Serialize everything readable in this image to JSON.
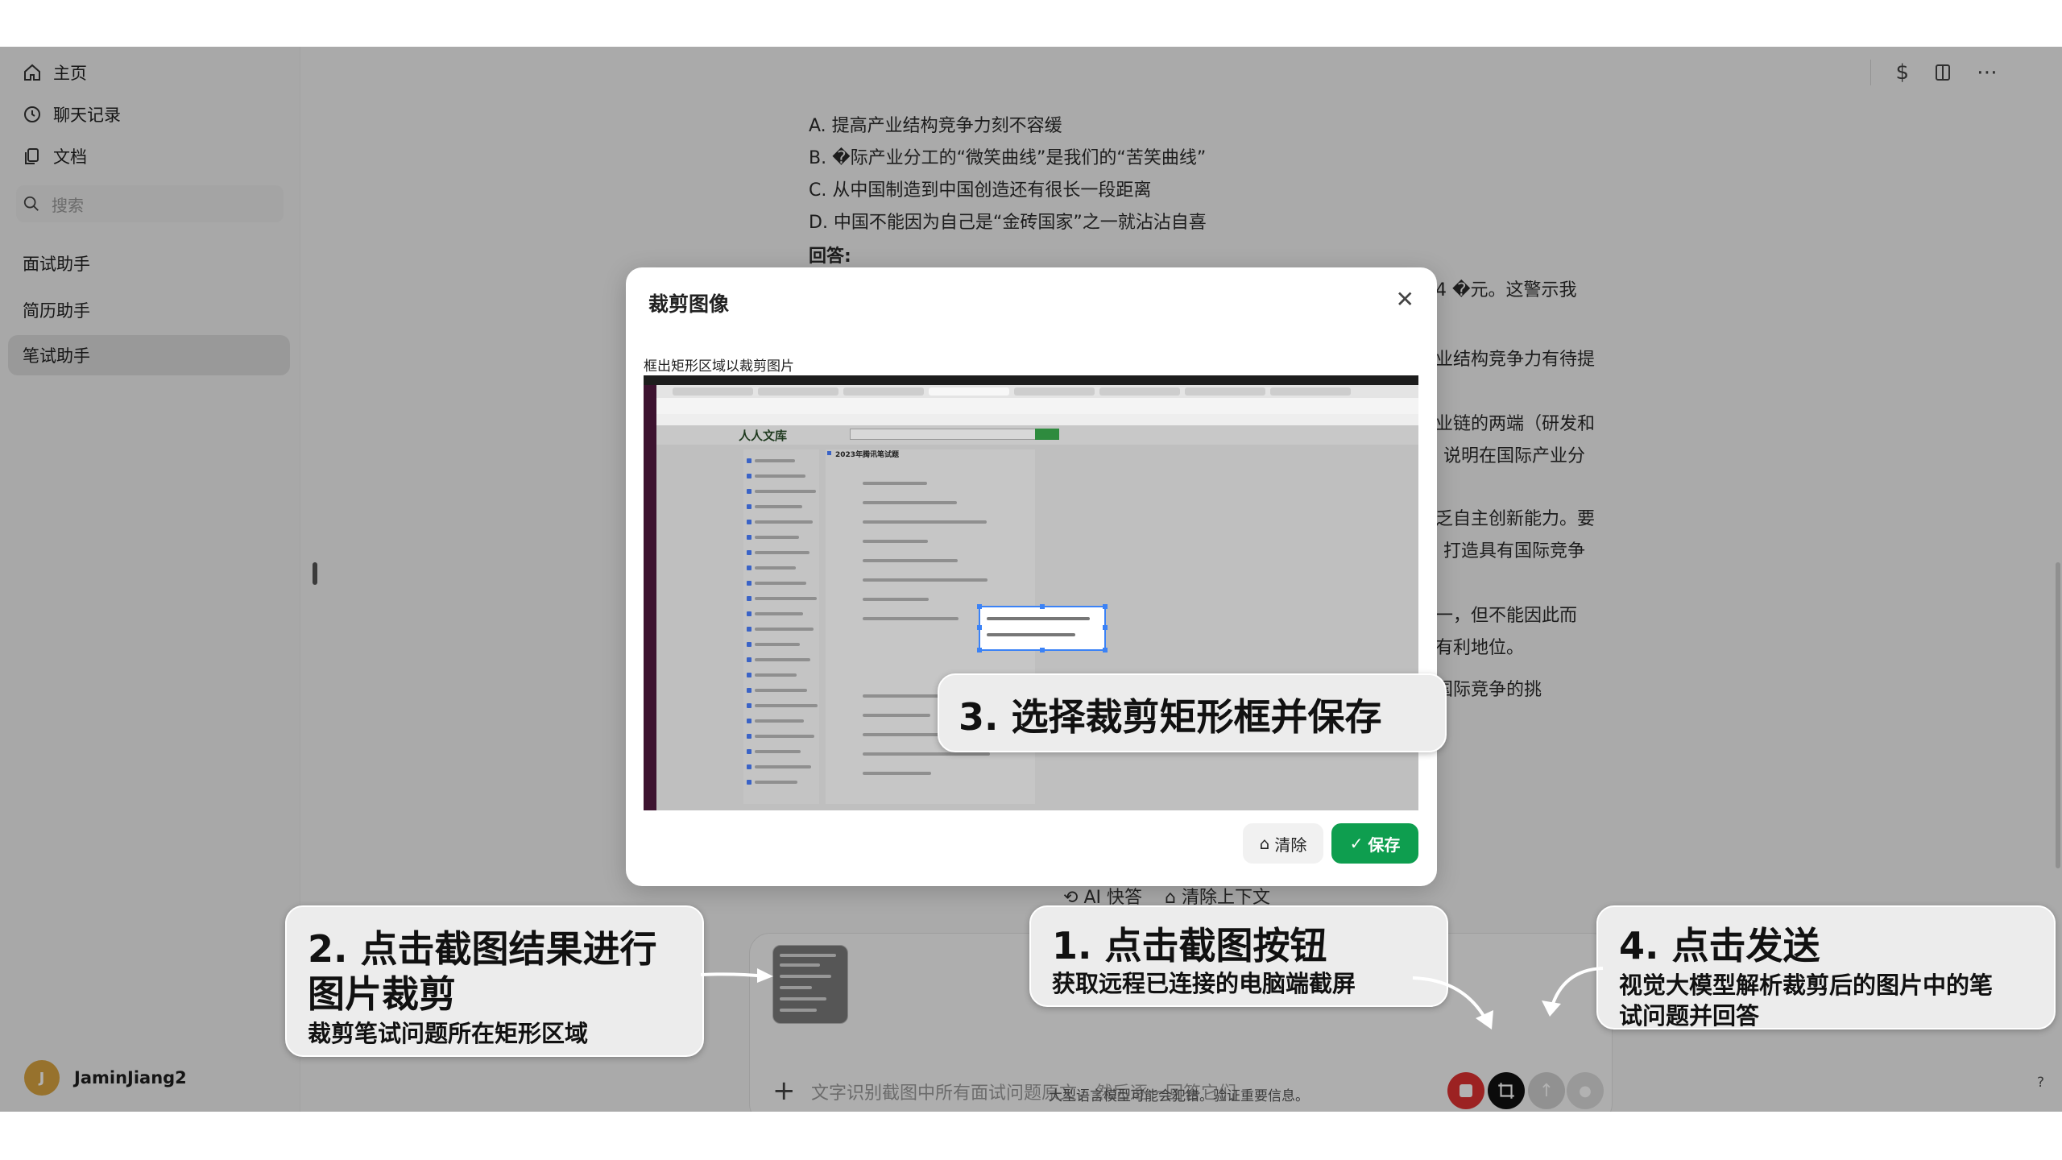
{
  "sidebar": {
    "nav": [
      {
        "label": "主页",
        "icon": "home-icon"
      },
      {
        "label": "聊天记录",
        "icon": "chat-history-icon"
      },
      {
        "label": "文档",
        "icon": "document-icon"
      }
    ],
    "search_placeholder": "搜索",
    "assistants": [
      "面试助手",
      "简历助手",
      "笔试助手"
    ],
    "user": {
      "name": "JaminJiang2",
      "initial": "J"
    }
  },
  "main": {
    "question_options": [
      "A. 提高产业结构竞争力刻不容缓",
      "B. �际产业分工的“微笑曲线”是我们的“苦笑曲线”",
      "C. 从中国制造到中国创造还有很长一段距离",
      "D. 中国不能因为自己是“金砖国家”之一就沾沾自喜"
    ],
    "answer_label": "回答:",
    "answer_fragments": [
      "4 �元。这警示我",
      "业结构竞争力有待提",
      "业链的两端（研发和",
      "说明在国际产业分",
      "乏自主创新能力。要",
      "打造具有国际竞争",
      "一，但不能因此而",
      "有利地位。",
      "国际竞争的挑"
    ],
    "quick_actions": [
      "AI 快答",
      "清除上下文"
    ],
    "input_placeholder": "文字识别截图中所有面试问题原文，然后逐一回答它们",
    "disclaimer": "大型语言模型可能会犯错。验证重要信息。",
    "help": "?"
  },
  "modal": {
    "title": "裁剪图像",
    "hint": "框出矩形区域以裁剪图片",
    "clear_label": "清除",
    "save_label": "保存",
    "close_symbol": "✕",
    "screenshot": {
      "site_name": "人人文库",
      "doc_title": "2023年腾讯笔试题"
    }
  },
  "callouts": {
    "step1": {
      "title": "1. 点击截图按钮",
      "sub": "获取远程已连接的电脑端截屏"
    },
    "step2": {
      "title_line1": "2. 点击截图结果进行",
      "title_line2": "图片裁剪",
      "sub": "裁剪笔试问题所在矩形区域"
    },
    "step3": {
      "title": "3. 选择裁剪矩形框并保存"
    },
    "step4": {
      "title": "4. 点击发送",
      "sub_line1": "视觉大模型解析裁剪后的图片中的笔",
      "sub_line2": "试问题并回答"
    }
  },
  "colors": {
    "save_green": "#0e9e4f",
    "stop_red": "#e03131",
    "crop_blue": "#3b82f6"
  }
}
